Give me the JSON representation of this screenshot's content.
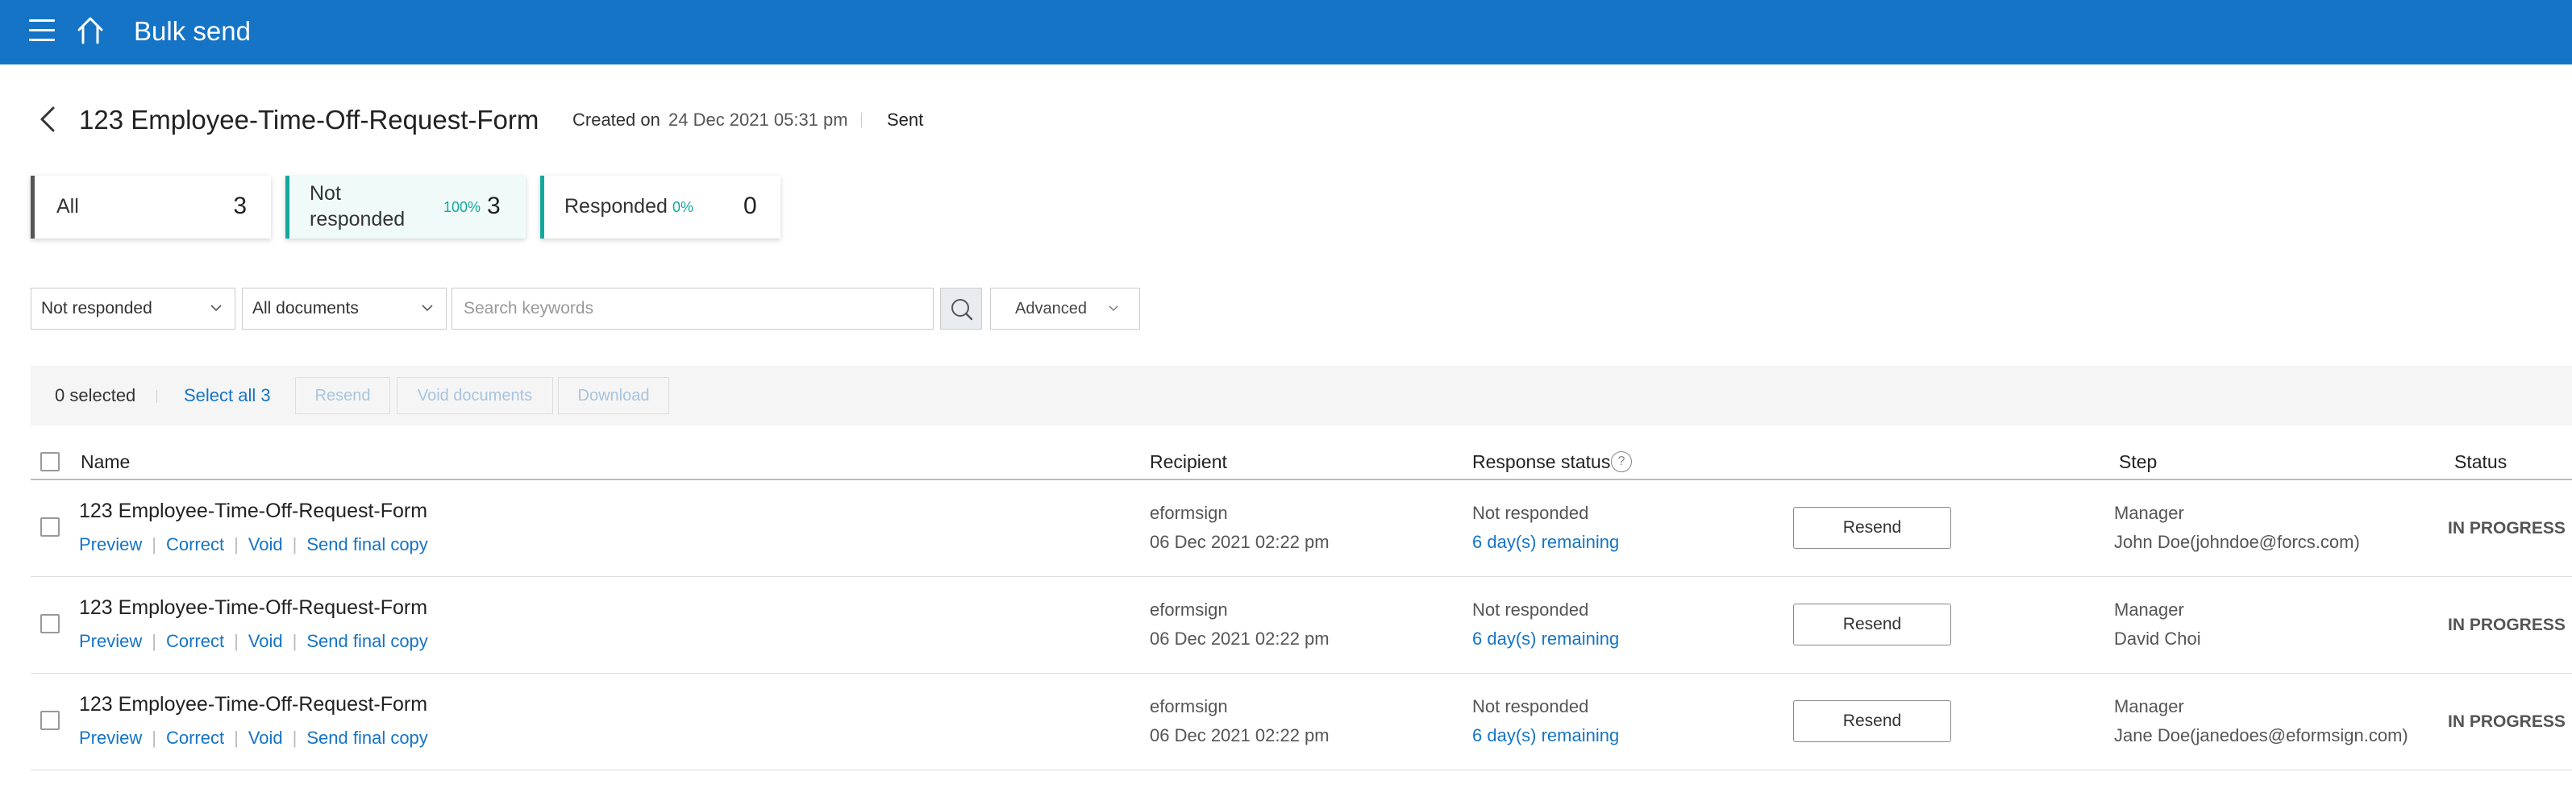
{
  "app": {
    "title": "Bulk send"
  },
  "header": {
    "doc_title": "123 Employee-Time-Off-Request-Form",
    "created_label": "Created on",
    "created_value": "24 Dec 2021 05:31 pm",
    "sent_label": "Sent"
  },
  "cards": [
    {
      "label": "All",
      "pct": "",
      "count": "3"
    },
    {
      "label": "Not responded",
      "pct": "100%",
      "count": "3"
    },
    {
      "label": "Responded",
      "pct": "0%",
      "count": "0"
    }
  ],
  "filters": {
    "status_value": "Not responded",
    "documents_value": "All documents",
    "search_placeholder": "Search keywords",
    "advanced_label": "Advanced"
  },
  "actionbar": {
    "selected": "0 selected",
    "select_all": "Select all 3",
    "resend": "Resend",
    "void": "Void documents",
    "download": "Download"
  },
  "table": {
    "columns": {
      "name": "Name",
      "recipient": "Recipient",
      "response_status": "Response status",
      "step": "Step",
      "status": "Status"
    },
    "help_glyph": "?",
    "rows": [
      {
        "name": "123 Employee-Time-Off-Request-Form",
        "links": [
          "Preview",
          "Correct",
          "Void",
          "Send final copy"
        ],
        "recipient": "eformsign",
        "date": "06 Dec 2021 02:22 pm",
        "response": "Not responded",
        "remaining": "6 day(s) remaining",
        "resend": "Resend",
        "step": "Manager",
        "step_person": "John Doe(johndoe@forcs.com)",
        "status": "IN PROGRESS"
      },
      {
        "name": "123 Employee-Time-Off-Request-Form",
        "links": [
          "Preview",
          "Correct",
          "Void",
          "Send final copy"
        ],
        "recipient": "eformsign",
        "date": "06 Dec 2021 02:22 pm",
        "response": "Not responded",
        "remaining": "6 day(s) remaining",
        "resend": "Resend",
        "step": "Manager",
        "step_person": "David Choi",
        "status": "IN PROGRESS"
      },
      {
        "name": "123 Employee-Time-Off-Request-Form",
        "links": [
          "Preview",
          "Correct",
          "Void",
          "Send final copy"
        ],
        "recipient": "eformsign",
        "date": "06 Dec 2021 02:22 pm",
        "response": "Not responded",
        "remaining": "6 day(s) remaining",
        "resend": "Resend",
        "step": "Manager",
        "step_person": "Jane Doe(janedoes@eformsign.com)",
        "status": "IN PROGRESS"
      }
    ]
  },
  "colors": {
    "topbar": "#1574c6",
    "link": "#1574c6",
    "accent_teal": "#13a89e",
    "card_all_bar": "#555555"
  },
  "icons": [
    "menu-icon",
    "home-icon",
    "back-arrow-icon",
    "chevron-down-icon",
    "search-icon",
    "help-icon"
  ]
}
